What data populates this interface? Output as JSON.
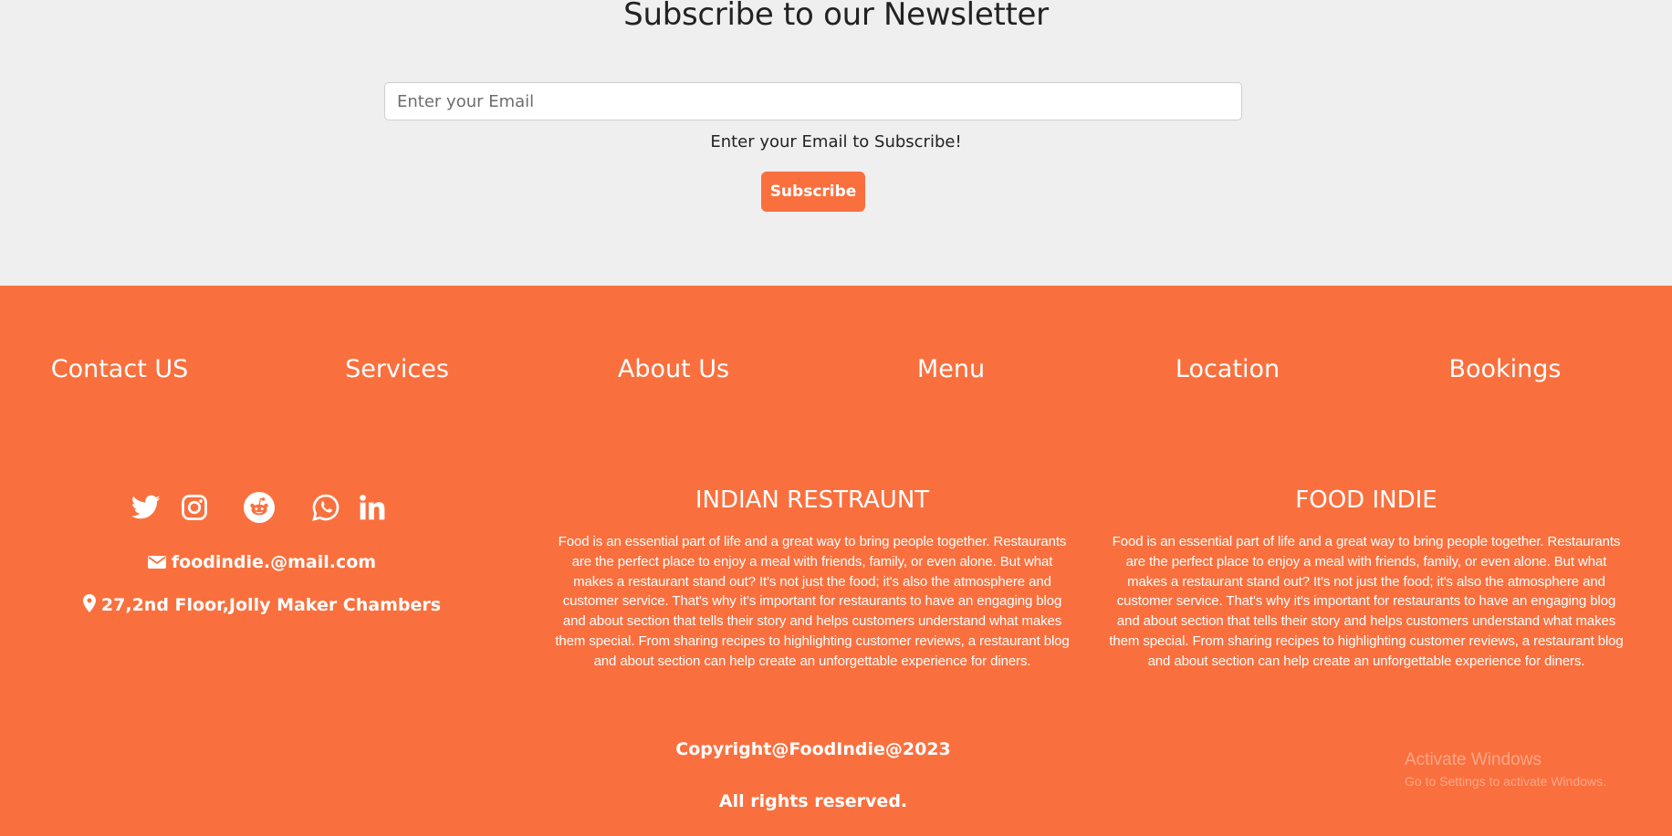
{
  "newsletter": {
    "title": "Subscribe to our Newsletter",
    "email_placeholder": "Enter your Email",
    "email_value": "",
    "help_text": "Enter your Email to Subscribe!",
    "subscribe_label": "Subscribe"
  },
  "nav": {
    "items": [
      {
        "label": "Contact US"
      },
      {
        "label": "Services"
      },
      {
        "label": "About Us"
      },
      {
        "label": "Menu"
      },
      {
        "label": "Location"
      },
      {
        "label": "Bookings"
      }
    ]
  },
  "social": {
    "icons": [
      "twitter-icon",
      "instagram-icon",
      "reddit-icon",
      "whatsapp-icon",
      "linkedin-icon"
    ]
  },
  "contact": {
    "email": "foodindie.@mail.com",
    "address": "27,2nd Floor,Jolly Maker Chambers"
  },
  "columns": [
    {
      "title": "INDIAN RESTRAUNT",
      "text": "Food is an essential part of life and a great way to bring people together. Restaurants are the perfect place to enjoy a meal with friends, family, or even alone. But what makes a restaurant stand out? It's not just the food; it's also the atmosphere and customer service. That's why it's important for restaurants to have an engaging blog and about section that tells their story and helps customers understand what makes them special. From sharing recipes to highlighting customer reviews, a restaurant blog and about section can help create an unforgettable experience for diners."
    },
    {
      "title": "FOOD INDIE",
      "text": "Food is an essential part of life and a great way to bring people together. Restaurants are the perfect place to enjoy a meal with friends, family, or even alone. But what makes a restaurant stand out? It's not just the food; it's also the atmosphere and customer service. That's why it's important for restaurants to have an engaging blog and about section that tells their story and helps customers understand what makes them special. From sharing recipes to highlighting customer reviews, a restaurant blog and about section can help create an unforgettable experience for diners."
    }
  ],
  "footer": {
    "copyright": "Copyright@FoodIndie@2023",
    "rights": "All rights reserved."
  },
  "watermark": {
    "line1": "Activate Windows",
    "line2": "Go to Settings to activate Windows."
  },
  "colors": {
    "accent": "#f9703e",
    "background": "#efefef",
    "text_dark": "#222222",
    "text_light": "#ffffff"
  }
}
